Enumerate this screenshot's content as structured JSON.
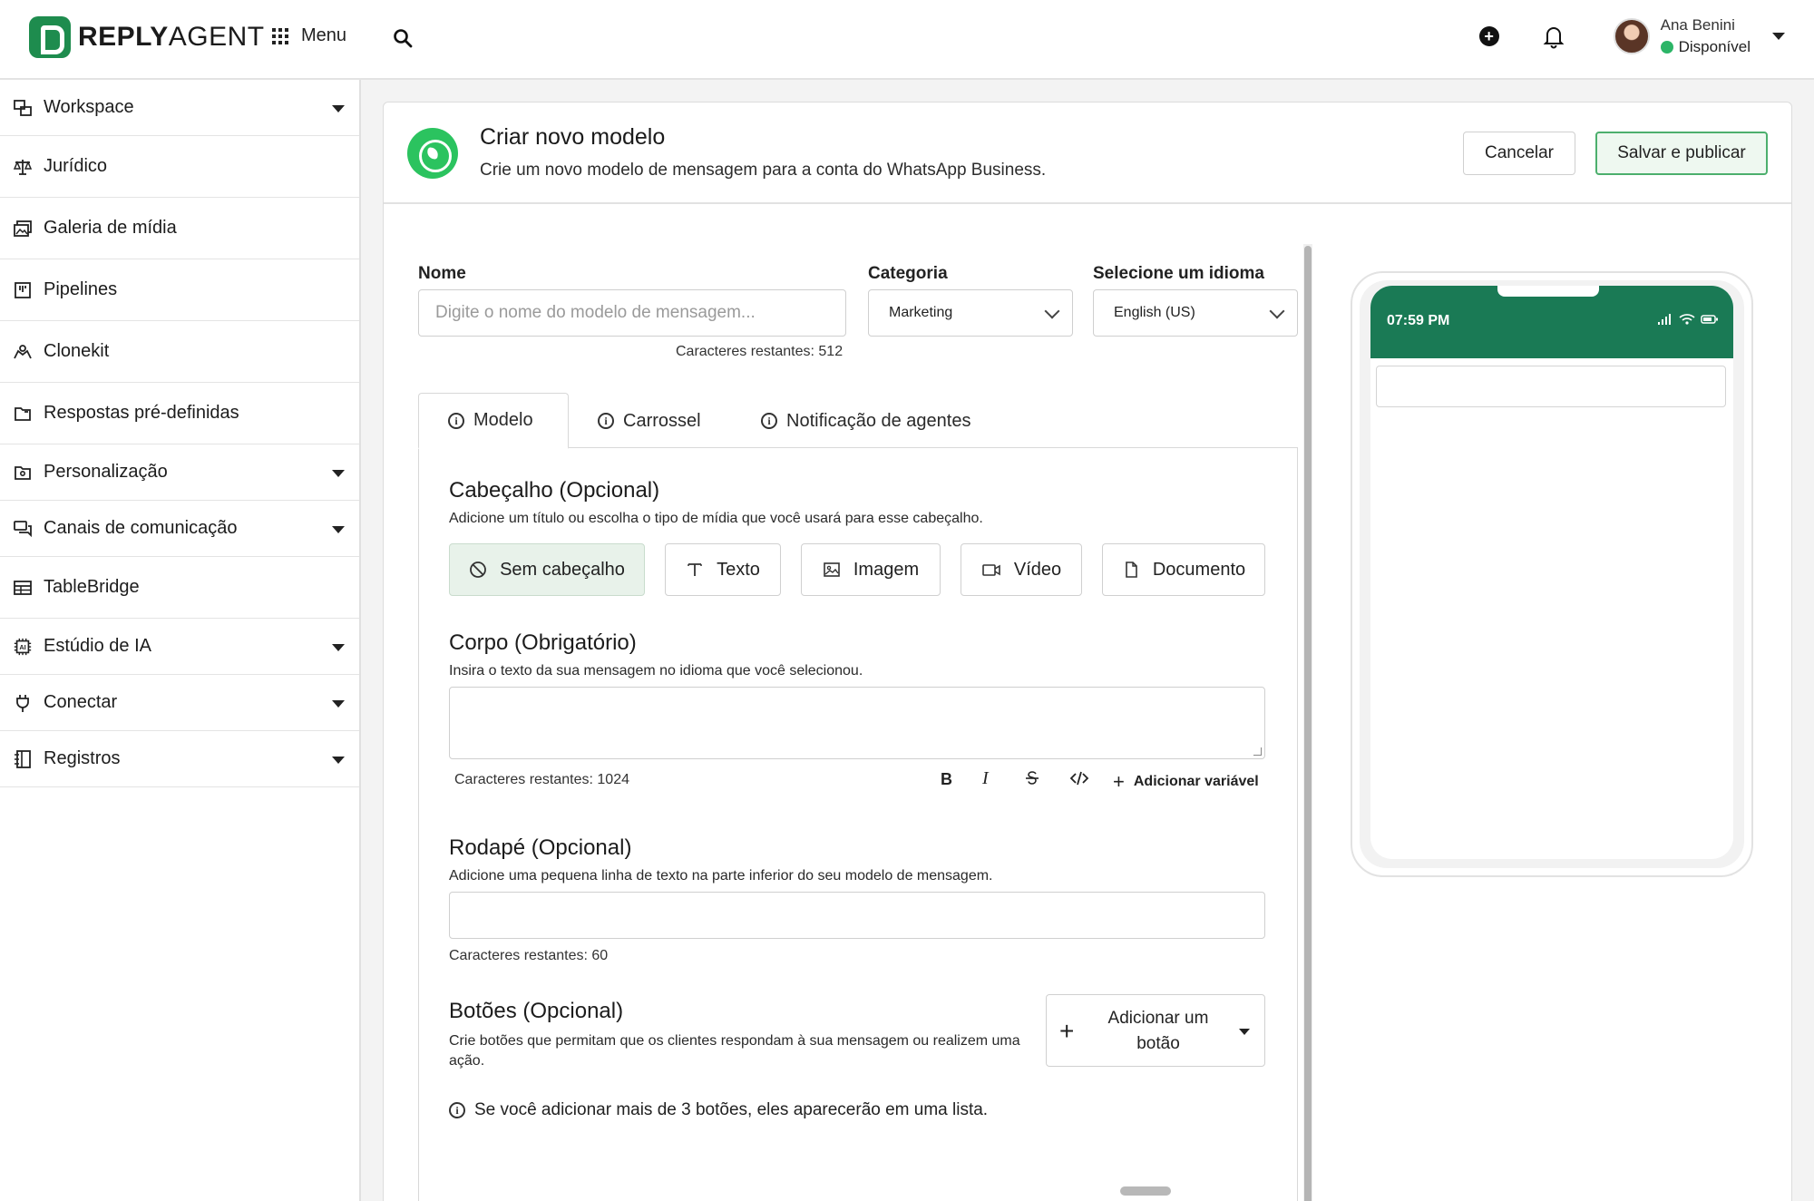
{
  "app": {
    "brand_bold": "REPLY",
    "brand_light": "AGENT"
  },
  "topbar": {
    "menu_label": "Menu",
    "user_name": "Ana Benini",
    "user_status": "Disponível"
  },
  "sidebar": {
    "items": [
      {
        "label": "Workspace",
        "icon": "workspace-icon",
        "has_caret": true
      },
      {
        "label": "Jurídico",
        "icon": "scale-icon",
        "has_caret": false
      },
      {
        "label": "Galeria de mídia",
        "icon": "gallery-icon",
        "has_caret": false
      },
      {
        "label": "Pipelines",
        "icon": "pipeline-icon",
        "has_caret": false
      },
      {
        "label": "Clonekit",
        "icon": "clone-icon",
        "has_caret": false
      },
      {
        "label": "Respostas pré-definidas",
        "icon": "canned-response-icon",
        "has_caret": false
      },
      {
        "label": "Personalização",
        "icon": "customize-icon",
        "has_caret": true
      },
      {
        "label": "Canais de comunicação",
        "icon": "chat-icon",
        "has_caret": true
      },
      {
        "label": "TableBridge",
        "icon": "table-icon",
        "has_caret": false
      },
      {
        "label": "Estúdio de IA",
        "icon": "ai-chip-icon",
        "has_caret": true
      },
      {
        "label": "Conectar",
        "icon": "plug-icon",
        "has_caret": true
      },
      {
        "label": "Registros",
        "icon": "log-icon",
        "has_caret": true
      }
    ]
  },
  "header": {
    "title": "Criar novo modelo",
    "subtitle": "Crie um novo modelo de mensagem para a conta do WhatsApp Business.",
    "cancel": "Cancelar",
    "save": "Salvar e publicar"
  },
  "form": {
    "name_label": "Nome",
    "name_placeholder": "Digite o nome do modelo de mensagem...",
    "name_remaining": "Caracteres restantes: 512",
    "category_label": "Categoria",
    "category_value": "Marketing",
    "language_label": "Selecione um idioma",
    "language_value": "English (US)"
  },
  "tabs": [
    {
      "label": "Modelo",
      "active": true
    },
    {
      "label": "Carrossel",
      "active": false
    },
    {
      "label": "Notificação de agentes",
      "active": false
    }
  ],
  "header_section": {
    "title": "Cabeçalho (Opcional)",
    "desc": "Adicione um título ou escolha o tipo de mídia que você usará para esse cabeçalho.",
    "options": [
      "Sem cabeçalho",
      "Texto",
      "Imagem",
      "Vídeo",
      "Documento"
    ],
    "selected": "Sem cabeçalho"
  },
  "body_section": {
    "title": "Corpo (Obrigatório)",
    "desc": "Insira o texto da sua mensagem no idioma que você selecionou.",
    "remaining": "Caracteres restantes: 1024",
    "bold": "B",
    "italic": "I",
    "add_variable": "Adicionar variável"
  },
  "footer_section": {
    "title": "Rodapé (Opcional)",
    "desc": "Adicione uma pequena linha de texto na parte inferior do seu modelo de mensagem.",
    "remaining": "Caracteres restantes: 60"
  },
  "buttons_section": {
    "title": "Botões (Opcional)",
    "desc": "Crie botões que permitam que os clientes respondam à sua mensagem ou realizem uma ação.",
    "add_button": "Adicionar um botão",
    "note": "Se você adicionar mais de 3 botões, eles aparecerão em uma lista."
  },
  "preview": {
    "time": "07:59 PM"
  },
  "colors": {
    "brand": "#1e8c4e",
    "whatsapp": "#2bc35f",
    "phone_header": "#1a7a55",
    "status_green": "#2cb567"
  }
}
